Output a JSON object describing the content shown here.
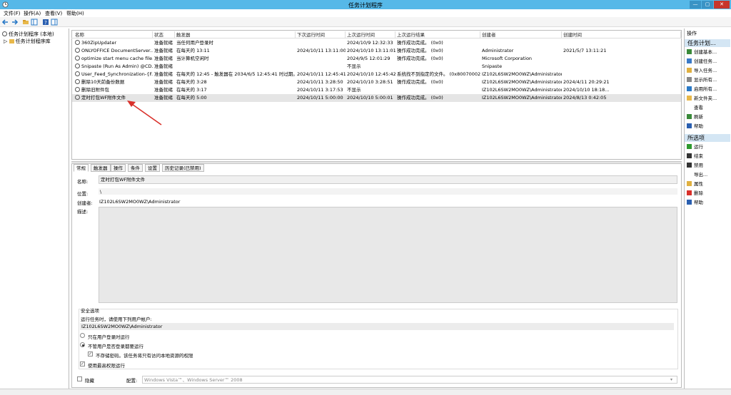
{
  "window": {
    "title": "任务计划程序"
  },
  "menu": [
    "文件(F)",
    "操作(A)",
    "查看(V)",
    "帮助(H)"
  ],
  "tree": {
    "root": "任务计划程序 (本地)",
    "child": "任务计划程序库"
  },
  "columns": [
    "名称",
    "状态",
    "触发器",
    "下次运行时间",
    "上次运行时间",
    "上次运行结果",
    "创建者",
    "创建时间"
  ],
  "rows": [
    [
      "360ZipUpdater",
      "准备就绪",
      "当任何用户登录时",
      "",
      "2024/10/9 12:32:33",
      "操作成功完成。 (0x0)",
      "",
      ""
    ],
    [
      "ONLYOFFICE DocumentServer...",
      "准备就绪",
      "在每天的 13:11",
      "2024/10/11 13:11:00",
      "2024/10/10 13:11:01",
      "操作成功完成。 (0x0)",
      "Administrator",
      "2021/5/7 13:11:21"
    ],
    [
      "optimize start menu cache file...",
      "准备就绪",
      "当计算机空闲时",
      "",
      "2024/9/5 12:01:29",
      "操作成功完成。 (0x0)",
      "Microsoft Corporation",
      ""
    ],
    [
      "Snipaste (Run As Admin) @CD...",
      "准备就绪",
      "",
      "",
      "不显示",
      "",
      "Snipaste",
      ""
    ],
    [
      "User_Feed_Synchronization-{F...",
      "准备就绪",
      "在每天的 12:45 - 触发器在 2034/6/5 12:45:41 时过期。",
      "2024/10/11 12:45:41",
      "2024/10/10 12:45:42",
      "系统找不到指定的文件。 (0x80070002)",
      "IZ102L6SW2MO0WZ\\Administrator",
      ""
    ],
    [
      "删除10天前备份数据",
      "准备就绪",
      "在每天的 3:28",
      "2024/10/11 3:28:50",
      "2024/10/10 3:28:51",
      "操作成功完成。 (0x0)",
      "IZ102L6SW2MO0WZ\\Administrator",
      "2024/4/11 20:29:21"
    ],
    [
      "删除旧附件包",
      "准备就绪",
      "在每天的 3:17",
      "2024/10/11 3:17:53",
      "不显示",
      "",
      "IZ102L6SW2MO0WZ\\Administrator",
      "2024/10/10 18:18..."
    ],
    [
      "定时打包WF附件文件",
      "准备就绪",
      "在每天的 5:00",
      "2024/10/11 5:00:00",
      "2024/10/10 5:00:01",
      "操作成功完成。 (0x0)",
      "IZ102L6SW2MO0WZ\\Administrator",
      "2024/8/13 0:42:05"
    ]
  ],
  "tabs": [
    "常规",
    "触发器",
    "操作",
    "条件",
    "设置",
    "历史记录(已禁用)"
  ],
  "general": {
    "name_label": "名称:",
    "name_value": "定时打包WF附件文件",
    "location_label": "位置:",
    "location_value": "\\",
    "author_label": "创建者:",
    "author_value": "IZ102L6SW2MO0WZ\\Administrator",
    "desc_label": "描述:"
  },
  "security": {
    "title": "安全选项",
    "run_as_label": "运行任务时，请使用下列用户帐户:",
    "account": "IZ102L6SW2MO0WZ\\Administrator",
    "opt1": "只在用户登录时运行",
    "opt2": "不管用户是否登录都要运行",
    "opt3": "不存储密码。该任务将只有访问本地资源的权限",
    "opt4": "使用最高权限运行"
  },
  "bottom": {
    "hidden": "隐藏",
    "config_label": "配置:",
    "config_value": "Windows Vista™、Windows Server™ 2008"
  },
  "actions": {
    "header": "操作",
    "section1": "任务计划...",
    "items1": [
      "创建基本...",
      "创建任务...",
      "导入任务...",
      "显示所有...",
      "启用所有...",
      "新文件夹...",
      "查看",
      "刷新",
      "帮助"
    ],
    "section2": "所选项",
    "items2": [
      "运行",
      "结束",
      "禁用",
      "导出...",
      "属性",
      "删除",
      "帮助"
    ]
  },
  "colors": {
    "titlebar": "#56b8e8",
    "arrow": "#d9302a",
    "selected": "#e5e5e5"
  }
}
